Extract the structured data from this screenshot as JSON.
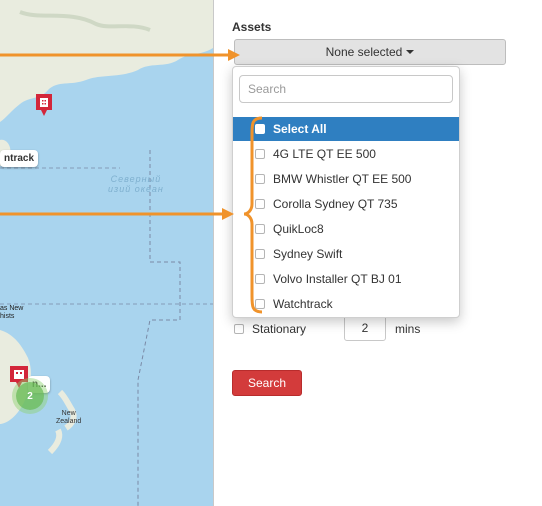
{
  "map": {
    "ocean_label_line1": "Северный",
    "ocean_label_line2": "изий океан",
    "asset_label_top": "ntrack",
    "asset_label_bottom": "n...",
    "cluster_count": "2",
    "place_new_zealand_1": "New",
    "place_new_zealand_2": "Zealand",
    "place_top_left_1": "as New",
    "place_top_left_2": "hists",
    "pin_color": "#d3263a",
    "water_color": "#a9d4ee",
    "land_color": "#e9ecdf",
    "icons": {
      "pin": "building-marker-icon",
      "cluster": "cluster-marker-icon"
    }
  },
  "panel": {
    "assets_title": "Assets",
    "dropdown_label": "None selected",
    "search_placeholder": "Search",
    "options": [
      "Select All",
      "4G LTE QT EE 500",
      "BMW Whistler QT EE 500",
      "Corolla Sydney QT 735",
      "QuikLoc8",
      "Sydney Swift",
      "Volvo Installer QT BJ 01",
      "Watchtrack"
    ],
    "stationary_label": "Stationary",
    "stationary_value": "2",
    "mins_label": "mins",
    "search_button": "Search",
    "accent_color": "#2f7fc1",
    "button_color": "#d33b3b"
  },
  "annotations": {
    "arrow_color": "#f0932b"
  }
}
